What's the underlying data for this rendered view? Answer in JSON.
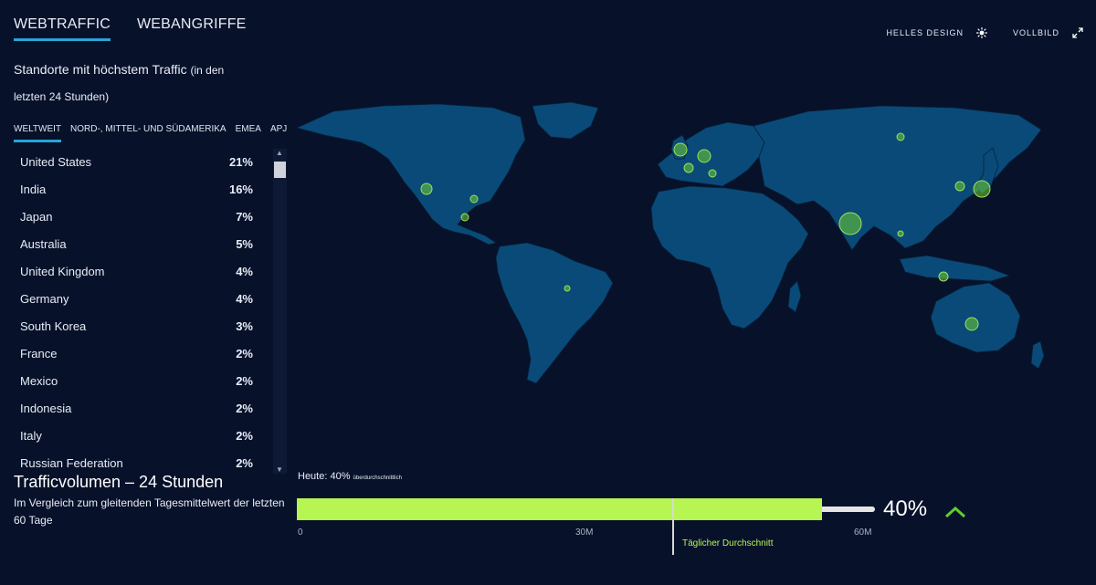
{
  "tabs": [
    {
      "label": "WEBTRAFFIC",
      "active": true
    },
    {
      "label": "WEBANGRIFFE",
      "active": false
    }
  ],
  "actions": {
    "light_design": "HELLES DESIGN",
    "light_icon": "sun-icon",
    "fullscreen": "VOLLBILD",
    "fullscreen_icon": "expand-icon"
  },
  "panel": {
    "title_main": "Standorte mit höchstem Traffic",
    "title_suffix_1": "(in den",
    "title_suffix_2": "letzten 24 Stunden)"
  },
  "regions": [
    {
      "label": "WELTWEIT",
      "active": true
    },
    {
      "label": "NORD-, MITTEL- UND SÜDAMERIKA",
      "active": false
    },
    {
      "label": "EMEA",
      "active": false
    },
    {
      "label": "APJ",
      "active": false
    }
  ],
  "locations": [
    {
      "country": "United States",
      "pct": "21%"
    },
    {
      "country": "India",
      "pct": "16%"
    },
    {
      "country": "Japan",
      "pct": "7%"
    },
    {
      "country": "Australia",
      "pct": "5%"
    },
    {
      "country": "United Kingdom",
      "pct": "4%"
    },
    {
      "country": "Germany",
      "pct": "4%"
    },
    {
      "country": "South Korea",
      "pct": "3%"
    },
    {
      "country": "France",
      "pct": "2%"
    },
    {
      "country": "Mexico",
      "pct": "2%"
    },
    {
      "country": "Indonesia",
      "pct": "2%"
    },
    {
      "country": "Italy",
      "pct": "2%"
    },
    {
      "country": "Russian Federation",
      "pct": "2%"
    }
  ],
  "volume": {
    "title": "Trafficvolumen – 24 Stunden",
    "subtitle": "Im Vergleich zum gleitenden Tagesmittelwert der letzten 60 Tage",
    "today_label": "Heute: 40%",
    "today_suffix": "überdurchschnittlich",
    "avg_label": "Täglicher Durchschnitt",
    "big_pct": "40%",
    "ticks": [
      "0",
      "30M",
      "60M"
    ],
    "trend_icon": "chevron-up-icon"
  },
  "colors": {
    "background": "#07112a",
    "land": "#0a4a78",
    "accent_blue": "#2aa3d8",
    "traffic_green": "#b7f552",
    "marker_green": "#6fcf2f"
  }
}
